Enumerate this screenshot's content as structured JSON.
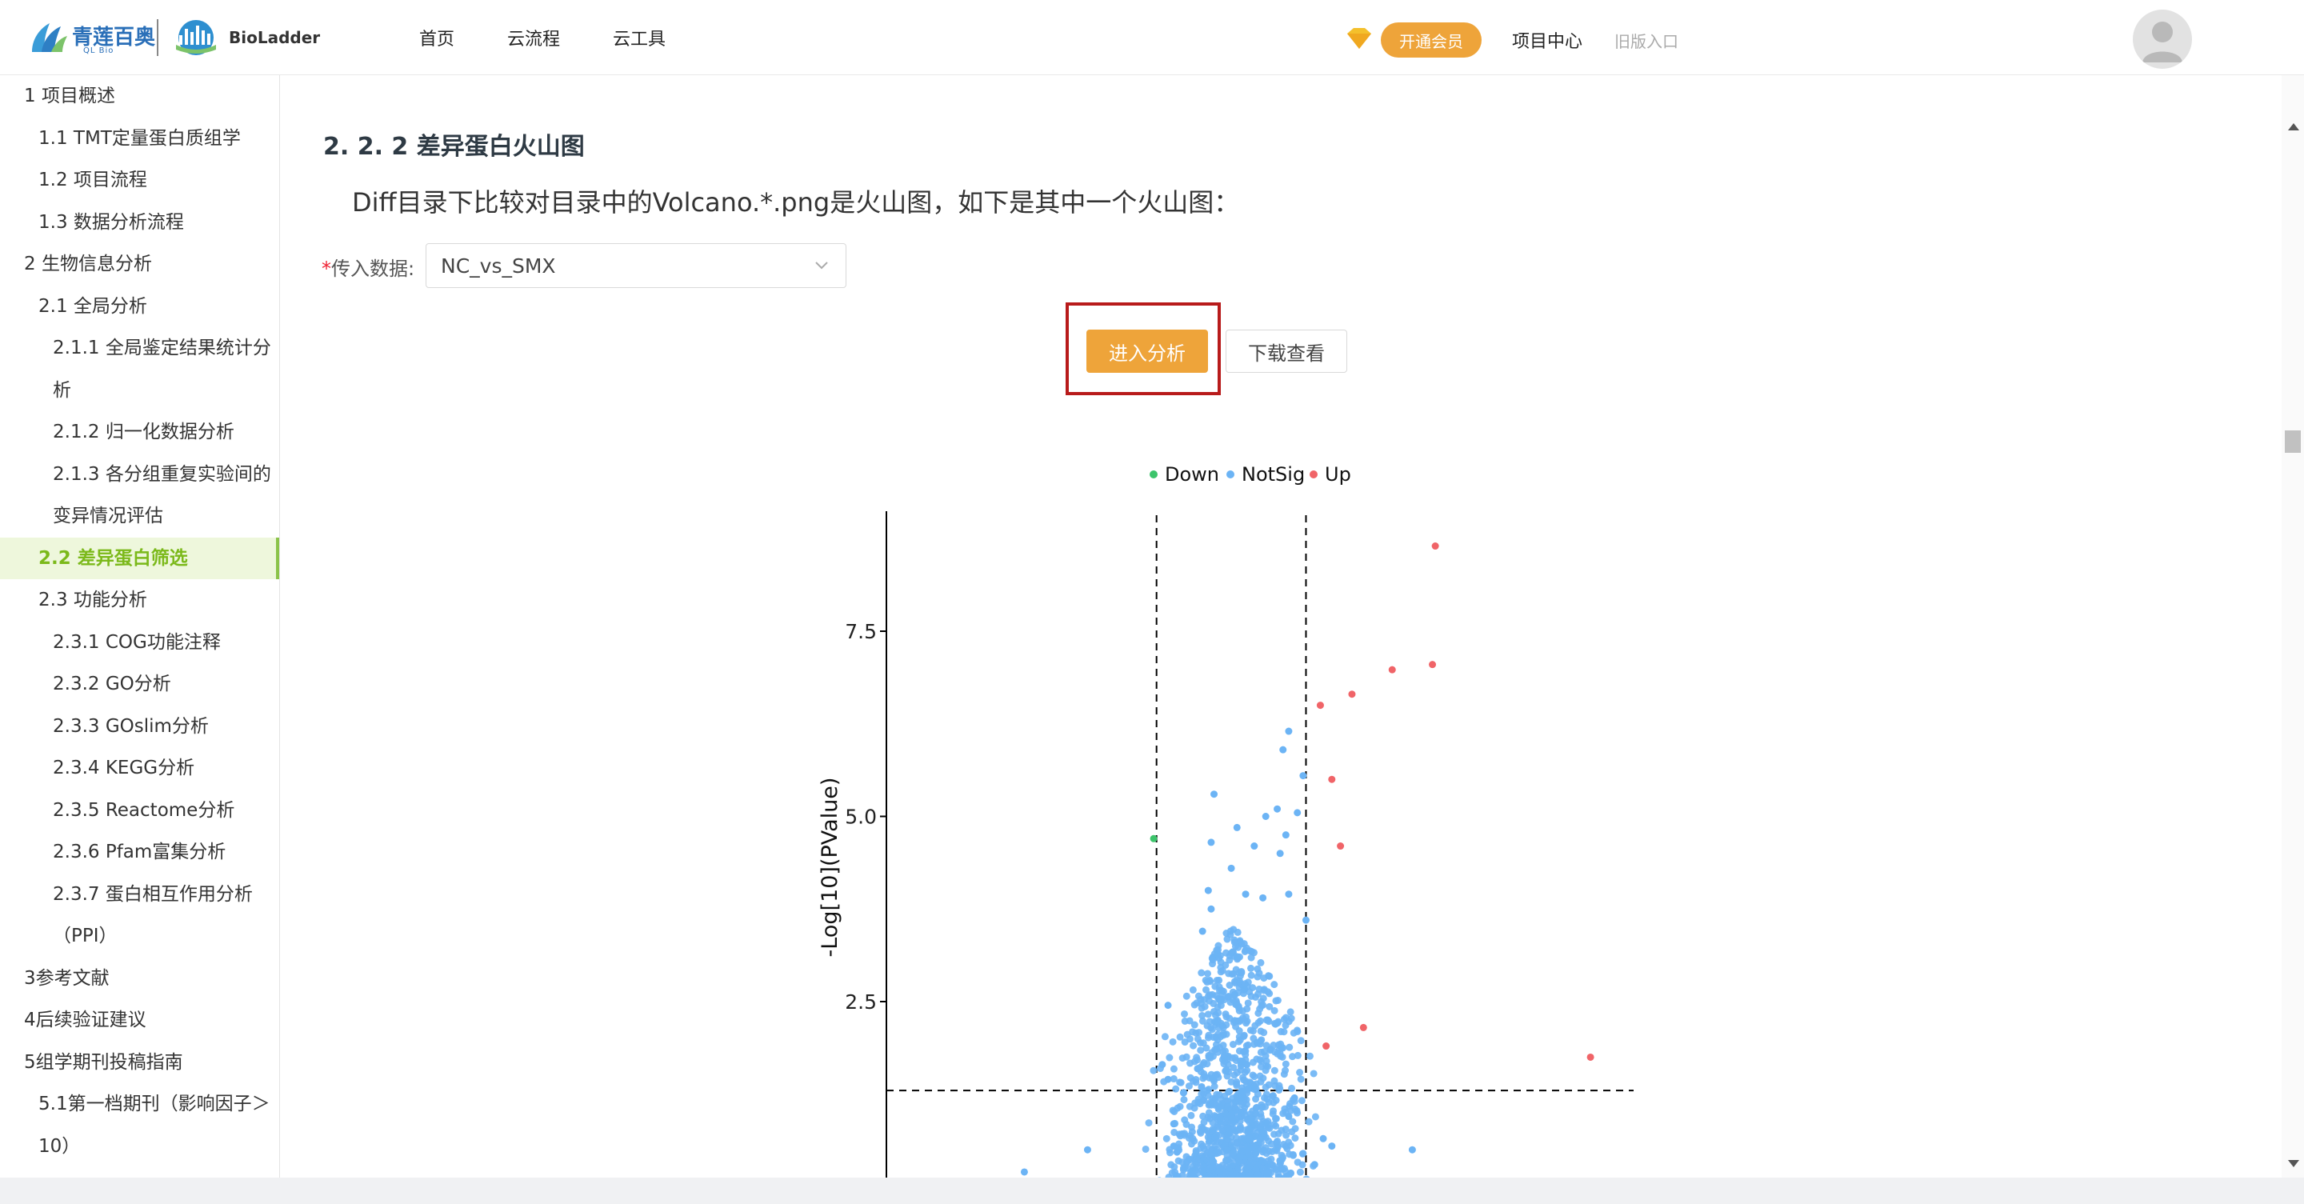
{
  "header": {
    "logo_brand": "青莲百奥",
    "logo_sub": "QL Bio",
    "logo_product": "BioLadder",
    "nav": [
      "首页",
      "云流程",
      "云工具"
    ],
    "vip_label": "开通会员",
    "project_center": "项目中心",
    "old_entry": "旧版入口"
  },
  "sidebar": {
    "items": [
      {
        "label": "1 项目概述",
        "level": 1
      },
      {
        "label": "1.1 TMT定量蛋白质组学",
        "level": 2
      },
      {
        "label": "1.2 项目流程",
        "level": 2
      },
      {
        "label": "1.3 数据分析流程",
        "level": 2
      },
      {
        "label": "2 生物信息分析",
        "level": 1
      },
      {
        "label": "2.1 全局分析",
        "level": 2
      },
      {
        "label": "2.1.1 全局鉴定结果统计分",
        "level": 3
      },
      {
        "label": "析",
        "level": 3
      },
      {
        "label": "2.1.2 归一化数据分析",
        "level": 3
      },
      {
        "label": "2.1.3 各分组重复实验间的",
        "level": 3
      },
      {
        "label": "变异情况评估",
        "level": 3
      },
      {
        "label": "2.2 差异蛋白筛选",
        "level": 2,
        "active": true
      },
      {
        "label": "2.3 功能分析",
        "level": 2
      },
      {
        "label": "2.3.1 COG功能注释",
        "level": 3
      },
      {
        "label": "2.3.2 GO分析",
        "level": 3
      },
      {
        "label": "2.3.3 GOslim分析",
        "level": 3
      },
      {
        "label": "2.3.4 KEGG分析",
        "level": 3
      },
      {
        "label": "2.3.5 Reactome分析",
        "level": 3
      },
      {
        "label": "2.3.6 Pfam富集分析",
        "level": 3
      },
      {
        "label": "2.3.7 蛋白相互作用分析",
        "level": 3
      },
      {
        "label": "（PPI）",
        "level": 3
      },
      {
        "label": "3参考文献",
        "level": 1
      },
      {
        "label": "4后续验证建议",
        "level": 1
      },
      {
        "label": "5组学期刊投稿指南",
        "level": 1
      },
      {
        "label": "5.1第一档期刊（影响因子＞",
        "level": 2
      },
      {
        "label": "10）",
        "level": 2
      }
    ]
  },
  "main": {
    "section_title": "2. 2. 2  差异蛋白火山图",
    "description": "Diff目录下比较对目录中的Volcano.*.png是火山图，如下是其中一个火山图：",
    "form_label": "传入数据:",
    "required_mark": "*",
    "select_value": "NC_vs_SMX",
    "analyze_button": "进入分析",
    "download_button": "下载查看"
  },
  "colors": {
    "accent": "#eea43a",
    "highlight": "#b81b1b",
    "down": "#3cc46b",
    "notsig": "#6cb4f5",
    "up": "#f06468",
    "active_green": "#7bb91a"
  },
  "chart_data": {
    "type": "scatter",
    "ylabel": "-Log[10](PValue)",
    "yticks": [
      "2.5",
      "5.0",
      "7.5"
    ],
    "ytick_values": [
      2.5,
      5.0,
      7.5
    ],
    "xlim": [
      -1.2,
      1.4
    ],
    "ylim": [
      0,
      9
    ],
    "thresholds": {
      "x": [
        -0.26,
        0.26
      ],
      "y": 1.3
    },
    "legend": {
      "position": "top",
      "entries": [
        "Down",
        "NotSig",
        "Up"
      ]
    },
    "series": [
      {
        "name": "Down",
        "color": "#3cc46b",
        "points": [
          [
            -0.27,
            4.7
          ]
        ]
      },
      {
        "name": "Up",
        "color": "#f06468",
        "points": [
          [
            0.71,
            8.65
          ],
          [
            0.7,
            7.05
          ],
          [
            0.56,
            6.98
          ],
          [
            0.42,
            6.65
          ],
          [
            0.31,
            6.5
          ],
          [
            0.35,
            5.5
          ],
          [
            0.38,
            4.6
          ],
          [
            0.46,
            2.15
          ],
          [
            0.33,
            1.9
          ],
          [
            1.25,
            1.75
          ]
        ]
      },
      {
        "name": "NotSig",
        "color": "#6cb4f5",
        "points": [
          [
            0.2,
            6.15
          ],
          [
            0.18,
            5.9
          ],
          [
            0.25,
            5.55
          ],
          [
            -0.06,
            5.3
          ],
          [
            0.16,
            5.1
          ],
          [
            0.23,
            5.05
          ],
          [
            0.12,
            5.0
          ],
          [
            0.02,
            4.85
          ],
          [
            0.19,
            4.75
          ],
          [
            -0.07,
            4.65
          ],
          [
            0.08,
            4.6
          ],
          [
            0.17,
            4.5
          ],
          [
            0.0,
            4.3
          ],
          [
            -0.08,
            4.0
          ],
          [
            0.05,
            3.95
          ],
          [
            0.11,
            3.9
          ],
          [
            0.2,
            3.95
          ],
          [
            -0.07,
            3.75
          ],
          [
            0.26,
            3.6
          ],
          [
            -0.1,
            3.45
          ],
          [
            -0.22,
            2.45
          ],
          [
            -0.24,
            1.65
          ],
          [
            -0.22,
            1.45
          ],
          [
            -0.5,
            0.5
          ],
          [
            -0.72,
            0.2
          ],
          [
            0.35,
            0.55
          ],
          [
            0.29,
            0.3
          ],
          [
            0.32,
            0.65
          ],
          [
            0.63,
            0.5
          ],
          [
            0.25,
            0.45
          ],
          [
            0.2,
            0.95
          ],
          [
            -0.2,
            0.55
          ],
          [
            -0.2,
            0.85
          ],
          [
            0.22,
            1.2
          ]
        ]
      }
    ]
  }
}
